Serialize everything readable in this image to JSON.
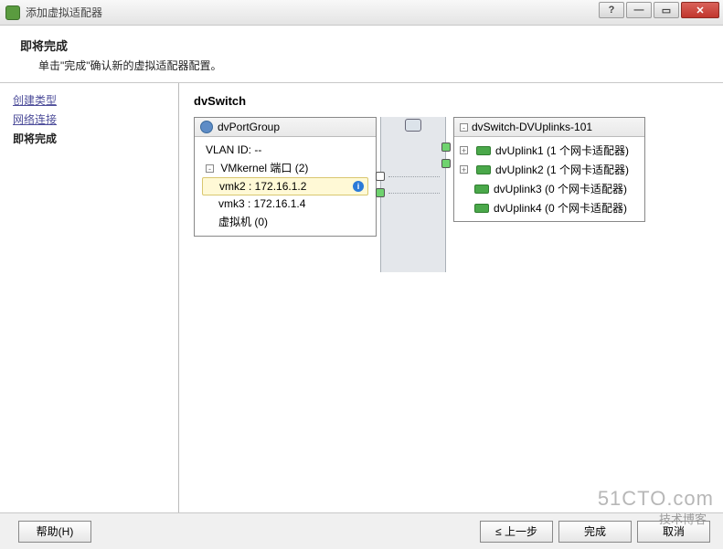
{
  "window": {
    "title": "添加虚拟适配器"
  },
  "header": {
    "title": "即将完成",
    "subtitle": "单击\"完成\"确认新的虚拟适配器配置。"
  },
  "nav": {
    "step1": "创建类型",
    "step2": "网络连接",
    "step3": "即将完成"
  },
  "main": {
    "title": "dvSwitch"
  },
  "portgroup": {
    "name": "dvPortGroup",
    "vlan_label": "VLAN ID:",
    "vlan_value": "--",
    "vmk_header": "VMkernel 端口 (2)",
    "vmk2": "vmk2 : 172.16.1.2",
    "vmk3": "vmk3 : 172.16.1.4",
    "vm_label": "虚拟机 (0)"
  },
  "uplinks": {
    "name": "dvSwitch-DVUplinks-101",
    "u1": "dvUplink1 (1 个网卡适配器)",
    "u2": "dvUplink2 (1 个网卡适配器)",
    "u3": "dvUplink3 (0 个网卡适配器)",
    "u4": "dvUplink4 (0 个网卡适配器)"
  },
  "buttons": {
    "help": "帮助(H)",
    "back": "≤ 上一步",
    "finish": "完成",
    "cancel": "取消"
  },
  "watermark": {
    "site": "51CTO.com",
    "tag": "技术博客"
  }
}
